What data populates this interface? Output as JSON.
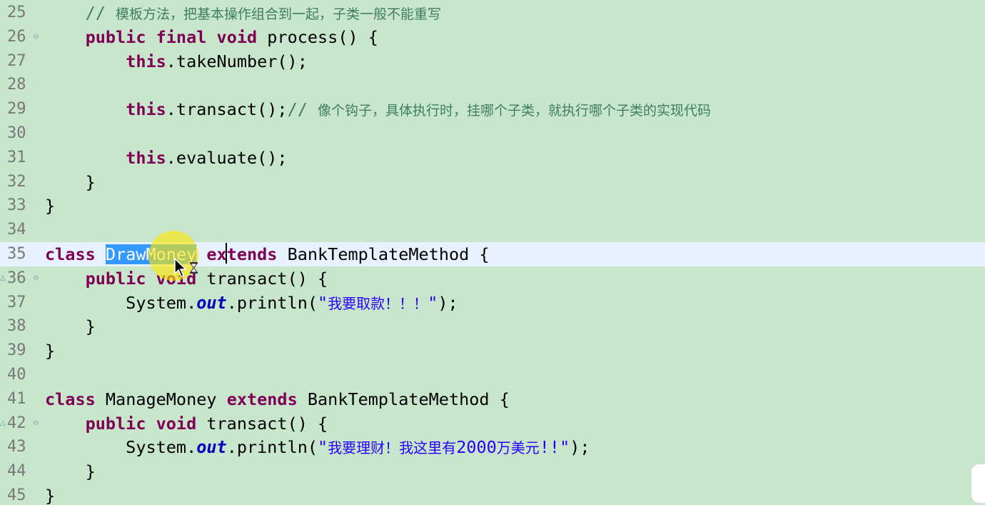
{
  "editor": {
    "lines": [
      {
        "num": "25",
        "tokens": [
          {
            "t": "    ",
            "c": "pl"
          },
          {
            "t": "// ",
            "c": "cm"
          },
          {
            "t": "模板方法，把基本操作组合到一起，子类一般不能重写",
            "c": "cm cm-cjk"
          }
        ]
      },
      {
        "num": "26",
        "fold": "⊖",
        "tokens": [
          {
            "t": "    ",
            "c": "pl"
          },
          {
            "t": "public",
            "c": "kw"
          },
          {
            "t": " ",
            "c": "pl"
          },
          {
            "t": "final",
            "c": "kw"
          },
          {
            "t": " ",
            "c": "pl"
          },
          {
            "t": "void",
            "c": "kw"
          },
          {
            "t": " process() {",
            "c": "pl"
          }
        ]
      },
      {
        "num": "27",
        "tokens": [
          {
            "t": "        ",
            "c": "pl"
          },
          {
            "t": "this",
            "c": "kw"
          },
          {
            "t": ".takeNumber();",
            "c": "pl"
          }
        ]
      },
      {
        "num": "28",
        "tokens": []
      },
      {
        "num": "29",
        "tokens": [
          {
            "t": "        ",
            "c": "pl"
          },
          {
            "t": "this",
            "c": "kw"
          },
          {
            "t": ".transact();",
            "c": "pl"
          },
          {
            "t": "// ",
            "c": "cm"
          },
          {
            "t": "像个钩子，具体执行时，挂哪个子类，就执行哪个子类的实现代码",
            "c": "cm cm-cjk"
          }
        ]
      },
      {
        "num": "30",
        "tokens": []
      },
      {
        "num": "31",
        "tokens": [
          {
            "t": "        ",
            "c": "pl"
          },
          {
            "t": "this",
            "c": "kw"
          },
          {
            "t": ".evaluate();",
            "c": "pl"
          }
        ]
      },
      {
        "num": "32",
        "tokens": [
          {
            "t": "    }",
            "c": "pl"
          }
        ]
      },
      {
        "num": "33",
        "tokens": [
          {
            "t": "}",
            "c": "pl"
          }
        ]
      },
      {
        "num": "34",
        "tokens": []
      },
      {
        "num": "35",
        "current": true,
        "tokens": [
          {
            "t": "class",
            "c": "kw"
          },
          {
            "t": " ",
            "c": "pl"
          },
          {
            "t": "DrawMoney",
            "c": "pl sel"
          },
          {
            "t": " ",
            "c": "pl"
          },
          {
            "t": "extends",
            "c": "kw"
          },
          {
            "t": " BankTemplateMethod {",
            "c": "pl"
          }
        ]
      },
      {
        "num": "36",
        "fold": "⊖",
        "override": "△",
        "tokens": [
          {
            "t": "    ",
            "c": "pl"
          },
          {
            "t": "public",
            "c": "kw"
          },
          {
            "t": " ",
            "c": "pl"
          },
          {
            "t": "void",
            "c": "kw"
          },
          {
            "t": " transact() {",
            "c": "pl"
          }
        ]
      },
      {
        "num": "37",
        "tokens": [
          {
            "t": "        System.",
            "c": "pl"
          },
          {
            "t": "out",
            "c": "fld"
          },
          {
            "t": ".println(",
            "c": "pl"
          },
          {
            "t": "\"",
            "c": "str"
          },
          {
            "t": "我要取款！！！",
            "c": "str str-cjk"
          },
          {
            "t": "\"",
            "c": "str"
          },
          {
            "t": ");",
            "c": "pl"
          }
        ]
      },
      {
        "num": "38",
        "tokens": [
          {
            "t": "    }",
            "c": "pl"
          }
        ]
      },
      {
        "num": "39",
        "tokens": [
          {
            "t": "}",
            "c": "pl"
          }
        ]
      },
      {
        "num": "40",
        "tokens": []
      },
      {
        "num": "41",
        "tokens": [
          {
            "t": "class",
            "c": "kw"
          },
          {
            "t": " ManageMoney ",
            "c": "pl"
          },
          {
            "t": "extends",
            "c": "kw"
          },
          {
            "t": " BankTemplateMethod {",
            "c": "pl"
          }
        ]
      },
      {
        "num": "42",
        "fold": "⊖",
        "override": "△",
        "tokens": [
          {
            "t": "    ",
            "c": "pl"
          },
          {
            "t": "public",
            "c": "kw"
          },
          {
            "t": " ",
            "c": "pl"
          },
          {
            "t": "void",
            "c": "kw"
          },
          {
            "t": " transact() {",
            "c": "pl"
          }
        ]
      },
      {
        "num": "43",
        "tokens": [
          {
            "t": "        System.",
            "c": "pl"
          },
          {
            "t": "out",
            "c": "fld"
          },
          {
            "t": ".println(",
            "c": "pl"
          },
          {
            "t": "\"",
            "c": "str"
          },
          {
            "t": "我要理财！我这里有",
            "c": "str str-cjk"
          },
          {
            "t": "2000",
            "c": "str"
          },
          {
            "t": "万美元",
            "c": "str str-cjk"
          },
          {
            "t": "!!\"",
            "c": "str"
          },
          {
            "t": ");",
            "c": "pl"
          }
        ]
      },
      {
        "num": "44",
        "tokens": [
          {
            "t": "    }",
            "c": "pl"
          }
        ]
      },
      {
        "num": "45",
        "tokens": [
          {
            "t": "}",
            "c": "pl"
          }
        ]
      }
    ]
  },
  "colors": {
    "background": "#c7e6cc",
    "current_line": "#e8f2fe",
    "keyword": "#7f0055",
    "comment": "#3f7f5f",
    "string": "#2a00ff",
    "field": "#0000c0",
    "selection": "#3399ff",
    "cursor_highlight": "#ffe600"
  },
  "icons": {
    "fold": "fold-collapse-icon",
    "override": "override-marker-icon",
    "mouse": "mouse-cursor-icon"
  }
}
